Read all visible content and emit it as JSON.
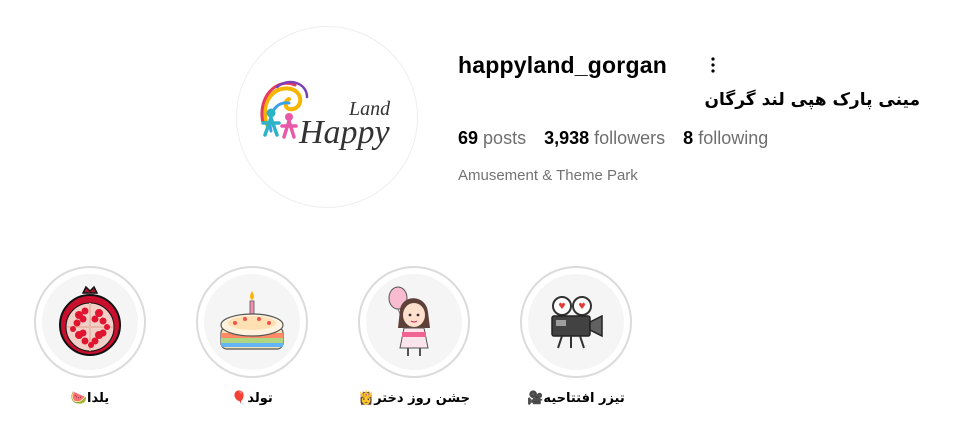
{
  "profile": {
    "username": "happyland_gorgan",
    "full_name": "مینی پارک هپی لند گرگان",
    "category": "Amusement & Theme Park",
    "logo_text": {
      "line1": "Land",
      "line2": "Happy"
    }
  },
  "stats": {
    "posts": {
      "count": "69",
      "label": "posts"
    },
    "followers": {
      "count": "3,938",
      "label": "followers"
    },
    "following": {
      "count": "8",
      "label": "following"
    }
  },
  "icons": {
    "more": "more-options-icon"
  },
  "highlights": [
    {
      "label": "یلدا🍉",
      "icon": "pomegranate-icon"
    },
    {
      "label": "تولد🎈",
      "icon": "birthday-cake-icon"
    },
    {
      "label": "جشن روز دختر👸",
      "icon": "girl-with-balloon-icon"
    },
    {
      "label": "تیزر افتتاحیه🎥",
      "icon": "movie-camera-icon"
    }
  ],
  "colors": {
    "text_primary": "#000000",
    "text_secondary": "#737373",
    "ring": "#dbdbdb",
    "highlight_bg": "#f5f5f5"
  }
}
